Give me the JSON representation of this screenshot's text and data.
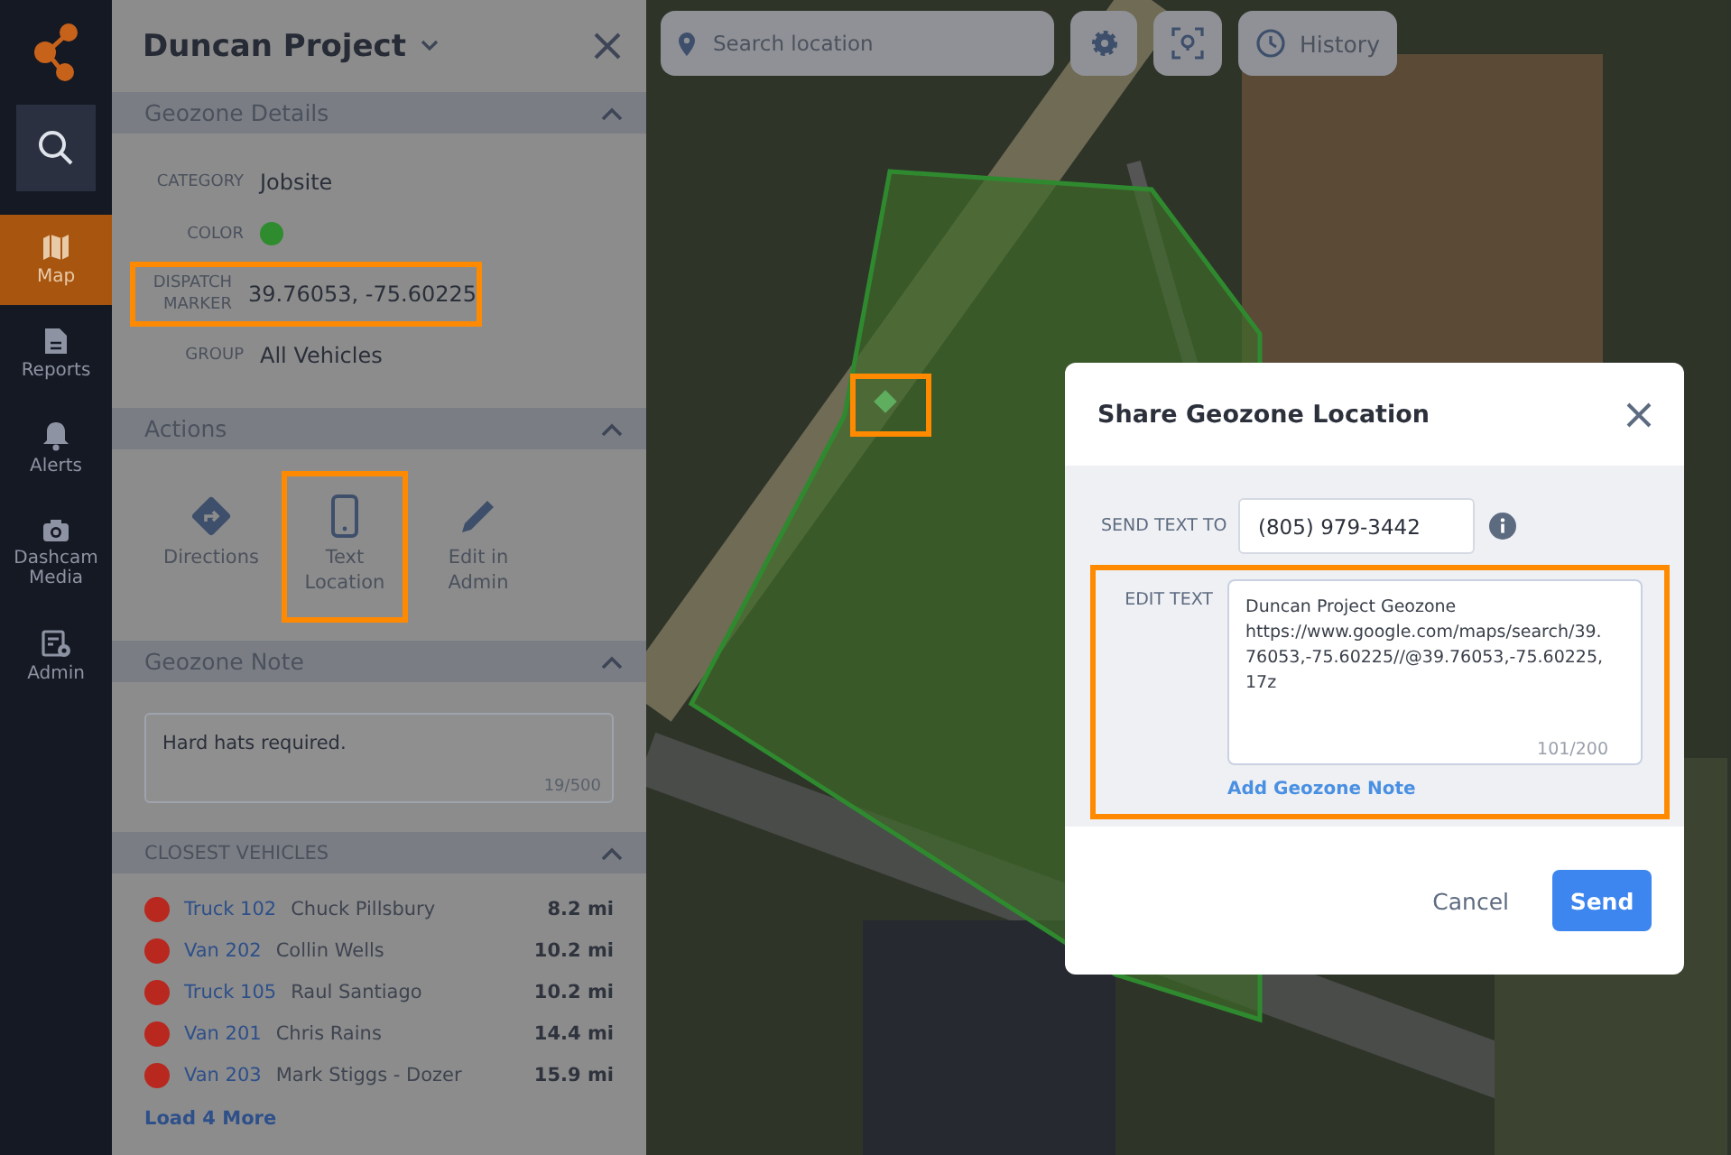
{
  "nav": {
    "search_selected": true,
    "items": [
      {
        "label": "Map",
        "selected": true
      },
      {
        "label": "Reports",
        "selected": false
      },
      {
        "label": "Alerts",
        "selected": false
      },
      {
        "label": "Dashcam Media",
        "selected": false
      },
      {
        "label": "Admin",
        "selected": false
      }
    ]
  },
  "panel": {
    "title": "Duncan Project",
    "details": {
      "title": "Geozone Details",
      "expanded": true,
      "fields": [
        {
          "kind": "text",
          "label": "CATEGORY",
          "value": "Jobsite",
          "highlighted": false
        },
        {
          "kind": "color",
          "label": "COLOR",
          "color": "#2e8b2e",
          "highlighted": false
        },
        {
          "kind": "text",
          "label": "DISPATCH MARKER",
          "value": "39.76053, -75.60225",
          "highlighted": true
        },
        {
          "kind": "text",
          "label": "GROUP",
          "value": "All Vehicles",
          "highlighted": false
        }
      ]
    },
    "actions": {
      "title": "Actions",
      "expanded": true,
      "items": [
        {
          "label": "Directions",
          "highlighted": false
        },
        {
          "label": "Text Location",
          "highlighted": true
        },
        {
          "label": "Edit in Admin",
          "highlighted": false
        }
      ]
    },
    "note": {
      "title": "Geozone Note",
      "expanded": true,
      "value": "Hard hats required.",
      "counter": "19/500"
    },
    "vehicles": {
      "title": "CLOSEST VEHICLES",
      "expanded": true,
      "items": [
        {
          "name": "Truck 102",
          "driver": "Chuck Pillsbury",
          "distance": "8.2 mi",
          "color": "#b8281f"
        },
        {
          "name": "Van 202",
          "driver": "Collin Wells",
          "distance": "10.2 mi",
          "color": "#b8281f"
        },
        {
          "name": "Truck 105",
          "driver": "Raul Santiago",
          "distance": "10.2 mi",
          "color": "#b8281f"
        },
        {
          "name": "Van 201",
          "driver": "Chris Rains",
          "distance": "14.4 mi",
          "color": "#b8281f"
        },
        {
          "name": "Van 203",
          "driver": "Mark Stiggs - Dozer",
          "distance": "15.9 mi",
          "color": "#b8281f"
        }
      ],
      "load_more": "Load 4 More"
    }
  },
  "map": {
    "search": {
      "placeholder": "Search location"
    },
    "history_button": "History",
    "marker_highlighted": true
  },
  "dialog": {
    "title": "Share Geozone Location",
    "send_to_label": "SEND TEXT TO",
    "phone": "(805) 979-3442",
    "edit_label": "EDIT TEXT",
    "message": "Duncan Project Geozone\nhttps://www.google.com/maps/search/39.76053,-75.60225//@39.76053,-75.60225,17z",
    "counter": "101/200",
    "add_note": "Add Geozone Note",
    "edit_highlighted": true,
    "cancel": "Cancel",
    "send": "Send"
  }
}
